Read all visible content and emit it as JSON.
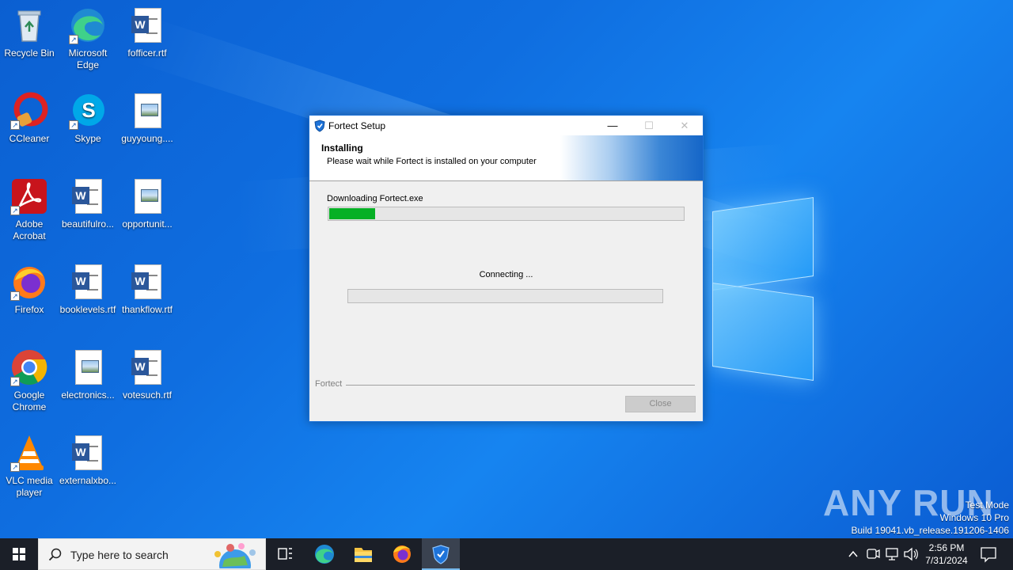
{
  "desktop": {
    "icons": [
      {
        "label": "Recycle Bin",
        "icon": "recycle-bin-icon"
      },
      {
        "label": "Microsoft Edge",
        "icon": "edge-icon"
      },
      {
        "label": "fofficer.rtf",
        "icon": "word-document-icon"
      },
      {
        "label": "CCleaner",
        "icon": "ccleaner-icon"
      },
      {
        "label": "Skype",
        "icon": "skype-icon"
      },
      {
        "label": "guyyoung....",
        "icon": "image-file-icon"
      },
      {
        "label": "Adobe Acrobat",
        "icon": "acrobat-icon"
      },
      {
        "label": "beautifulro...",
        "icon": "word-document-icon"
      },
      {
        "label": "opportunit...",
        "icon": "image-file-icon"
      },
      {
        "label": "Firefox",
        "icon": "firefox-icon"
      },
      {
        "label": "booklevels.rtf",
        "icon": "word-document-icon"
      },
      {
        "label": "thankflow.rtf",
        "icon": "word-document-icon"
      },
      {
        "label": "Google Chrome",
        "icon": "chrome-icon"
      },
      {
        "label": "electronics...",
        "icon": "image-file-icon"
      },
      {
        "label": "votesuch.rtf",
        "icon": "word-document-icon"
      },
      {
        "label": "VLC media player",
        "icon": "vlc-icon"
      },
      {
        "label": "externalxbo...",
        "icon": "word-document-icon"
      }
    ]
  },
  "dialog": {
    "title": "Fortect Setup",
    "header_title": "Installing",
    "header_subtitle": "Please wait while Fortect is installed on your computer",
    "download_label": "Downloading Fortect.exe",
    "download_progress": 0.13,
    "status_label": "Connecting ...",
    "status_progress": 0,
    "brand": "Fortect",
    "close_label": "Close",
    "minimize_symbol": "—",
    "maximize_symbol": "☐",
    "close_symbol": "✕"
  },
  "watermark": {
    "text": "ANY RUN",
    "line1": "Test Mode",
    "line2": "Windows 10 Pro",
    "line3": "Build 19041.vb_release.191206-1406"
  },
  "taskbar": {
    "search_placeholder": "Type here to search",
    "time": "2:56 PM",
    "date": "7/31/2024",
    "apps": [
      "task-view-icon",
      "edge-icon",
      "file-explorer-icon",
      "firefox-icon",
      "fortect-icon"
    ]
  },
  "colors": {
    "progress_fill": "#06b025",
    "accent": "#1e73d8",
    "taskbar": "#1b1f28"
  }
}
